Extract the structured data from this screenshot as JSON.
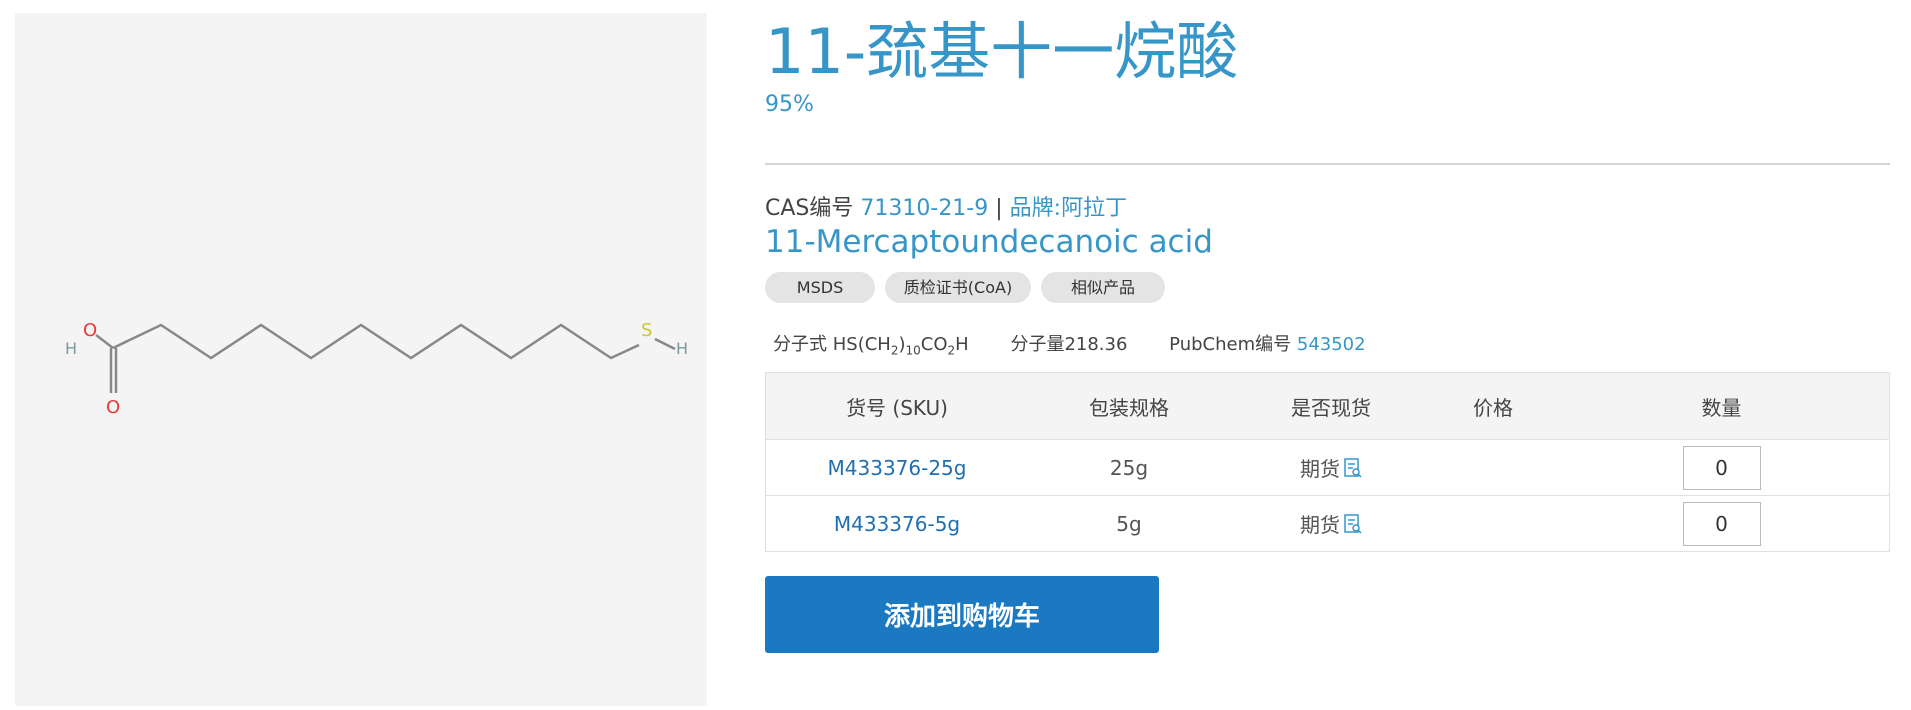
{
  "product": {
    "title": "11-巯基十一烷酸",
    "purity": "95%",
    "cas_label": "CAS编号",
    "cas_number": "71310-21-9",
    "separator": "|",
    "brand_label": "品牌:",
    "brand": "阿拉丁",
    "english_name": "11-Mercaptoundecanoic acid"
  },
  "chips": [
    "MSDS",
    "质检证书(CoA)",
    "相似产品"
  ],
  "properties": {
    "formula_label": "分子式",
    "formula_parts": {
      "a": "HS(CH",
      "b": "2",
      "c": ")",
      "d": "10",
      "e": "CO",
      "f": "2",
      "g": "H"
    },
    "mw_label": "分子量",
    "mw_value": "218.36",
    "pubchem_label": "PubChem编号",
    "pubchem_id": "543502"
  },
  "structure": {
    "atoms": {
      "h_left": "H",
      "o_top": "O",
      "o_bottom": "O",
      "s": "S",
      "h_right": "H"
    },
    "colors": {
      "oxygen": "#e83a3a",
      "sulfur": "#c9c92a",
      "hydrogen": "#7a9a9a",
      "bond": "#888888"
    }
  },
  "table": {
    "headers": [
      "货号 (SKU)",
      "包装规格",
      "是否现货",
      "价格",
      "数量"
    ],
    "rows": [
      {
        "sku": "M433376-25g",
        "pack": "25g",
        "stock": "期货",
        "price": "",
        "qty": "0"
      },
      {
        "sku": "M433376-5g",
        "pack": "5g",
        "stock": "期货",
        "price": "",
        "qty": "0"
      }
    ]
  },
  "add_to_cart_label": "添加到购物车",
  "colors": {
    "accent": "#3796c8",
    "button": "#1b79c2",
    "panel": "#f4f4f4"
  }
}
